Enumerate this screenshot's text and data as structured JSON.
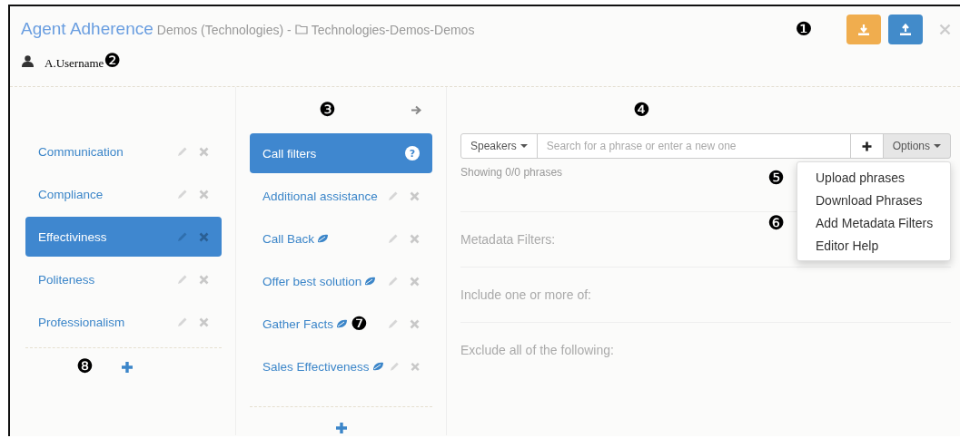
{
  "header": {
    "title": "Agent Adherence",
    "project": "Demos (Technologies) -",
    "folder": "Technologies-Demos-Demos",
    "user": "A.Username",
    "user_callout": "❷",
    "actions_callout": "❶"
  },
  "categories": {
    "callout": "❽",
    "items": [
      {
        "label": "Communication",
        "selected": false
      },
      {
        "label": "Compliance",
        "selected": false
      },
      {
        "label": "Effectiviness",
        "selected": true
      },
      {
        "label": "Politeness",
        "selected": false
      },
      {
        "label": "Professionalism",
        "selected": false
      }
    ]
  },
  "phrases": {
    "callout": "❸",
    "items": [
      {
        "label": "Call filters",
        "kind": "help",
        "badge": "?",
        "selected": true,
        "leaf": false
      },
      {
        "label": "Additional assistance",
        "kind": "phrase",
        "selected": false,
        "leaf": false
      },
      {
        "label": "Call Back",
        "kind": "phrase",
        "selected": false,
        "leaf": true
      },
      {
        "label": "Offer best solution",
        "kind": "phrase",
        "selected": false,
        "leaf": true
      },
      {
        "label": "Gather Facts",
        "kind": "phrase",
        "selected": false,
        "leaf": true,
        "callout": "❼"
      },
      {
        "label": "Sales Effectiveness",
        "kind": "phrase",
        "selected": false,
        "leaf": true
      }
    ]
  },
  "editor": {
    "callout": "❹",
    "speakers": "Speakers",
    "placeholder": "Search for a phrase or enter a new one",
    "options": "Options",
    "showing": "Showing 0/0 phrases",
    "sections": [
      "Metadata Filters:",
      "Include one or more of:",
      "Exclude all of the following:"
    ],
    "menu": [
      {
        "label": "Upload phrases",
        "callout": "❺"
      },
      {
        "label": "Download Phrases"
      },
      {
        "label": "Add Metadata Filters",
        "callout": "❻"
      },
      {
        "label": "Editor Help"
      }
    ]
  }
}
